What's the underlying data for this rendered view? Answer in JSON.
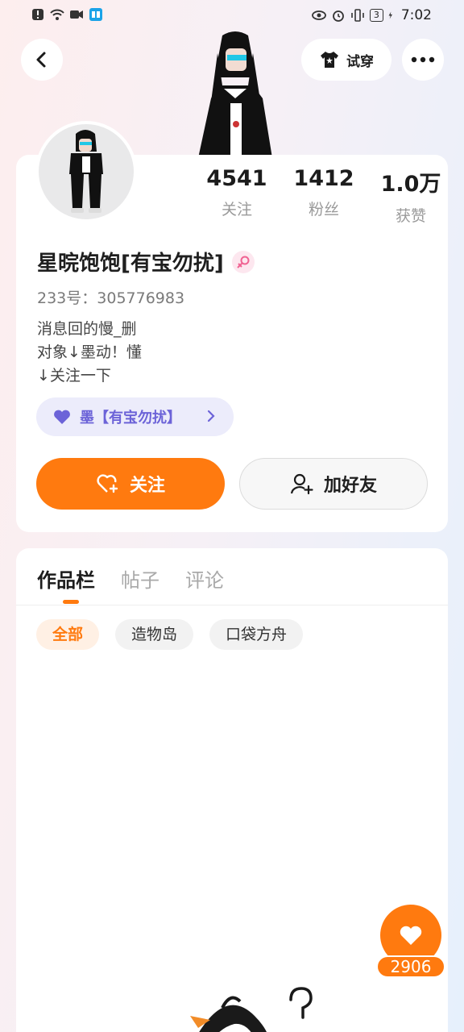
{
  "status_bar": {
    "time": "7:02",
    "battery": "3"
  },
  "top_bar": {
    "try_on_label": "试穿"
  },
  "stats": [
    {
      "value": "4541",
      "label": "关注"
    },
    {
      "value": "1412",
      "label": "粉丝"
    },
    {
      "value": "1.0万",
      "label": "获赞"
    }
  ],
  "profile": {
    "name": "星晥饱饱[有宝勿扰]",
    "uid": "233号：305776983",
    "bio": [
      "消息回的慢_删",
      "对象↓墨动！懂",
      "↓关注一下"
    ],
    "group_label": "墨【有宝勿扰】"
  },
  "actions": {
    "follow_label": "关注",
    "add_friend_label": "加好友"
  },
  "tabs": [
    {
      "label": "作品栏"
    },
    {
      "label": "帖子"
    },
    {
      "label": "评论"
    }
  ],
  "filters": [
    {
      "label": "全部"
    },
    {
      "label": "造物岛"
    },
    {
      "label": "口袋方舟"
    }
  ],
  "likes": {
    "count": "2906"
  },
  "colors": {
    "accent": "#ff7a0f",
    "group_pill": "#ececfb",
    "group_text": "#6c63d8"
  }
}
